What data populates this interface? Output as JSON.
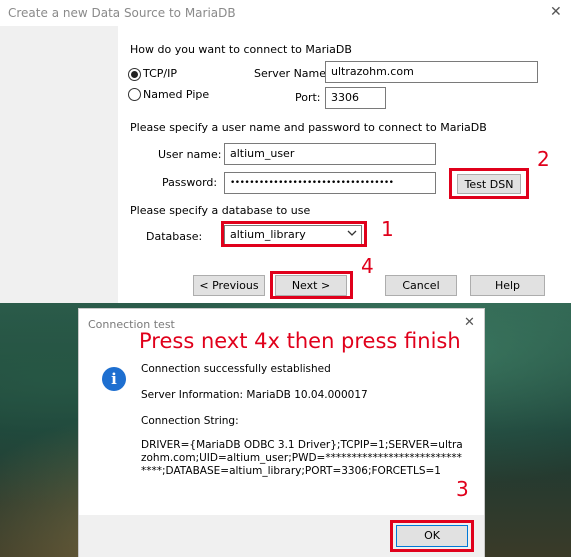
{
  "main_dialog": {
    "title": "Create a new Data Source to MariaDB",
    "close_symbol": "✕",
    "connect_prompt": "How do you want to connect to MariaDB",
    "tcp_label": "TCP/IP",
    "pipe_label": "Named Pipe",
    "server_label": "Server Name:",
    "server_value": "ultrazohm.com",
    "port_label": "Port:",
    "port_value": "3306",
    "credentials_prompt": "Please specify a user name and password to connect to MariaDB",
    "user_label": "User name:",
    "user_value": "altium_user",
    "password_label": "Password:",
    "password_value": "••••••••••••••••••••••••••••••••••",
    "test_button": "Test DSN",
    "database_prompt": "Please specify a database to use",
    "database_label": "Database:",
    "database_value": "altium_library",
    "prev_button": "< Previous",
    "next_button": "Next >",
    "cancel_button": "Cancel",
    "help_button": "Help"
  },
  "annotations": {
    "n1": "1",
    "n2": "2",
    "n3": "3",
    "n4": "4",
    "instruction": "Press next 4x then press finish",
    "color": "#e0001b"
  },
  "conn_dialog": {
    "title": "Connection test",
    "close_symbol": "✕",
    "icon": "info-icon",
    "icon_glyph": "i",
    "success": "Connection successfully established",
    "server_info": "Server Information: MariaDB 10.04.000017",
    "conn_string_label": "Connection String:",
    "conn_string": "DRIVER={MariaDB ODBC 3.1 Driver};TCPIP=1;SERVER=ultrazohm.com;UID=altium_user;PWD=******************************;DATABASE=altium_library;PORT=3306;FORCETLS=1",
    "ok_button": "OK"
  }
}
